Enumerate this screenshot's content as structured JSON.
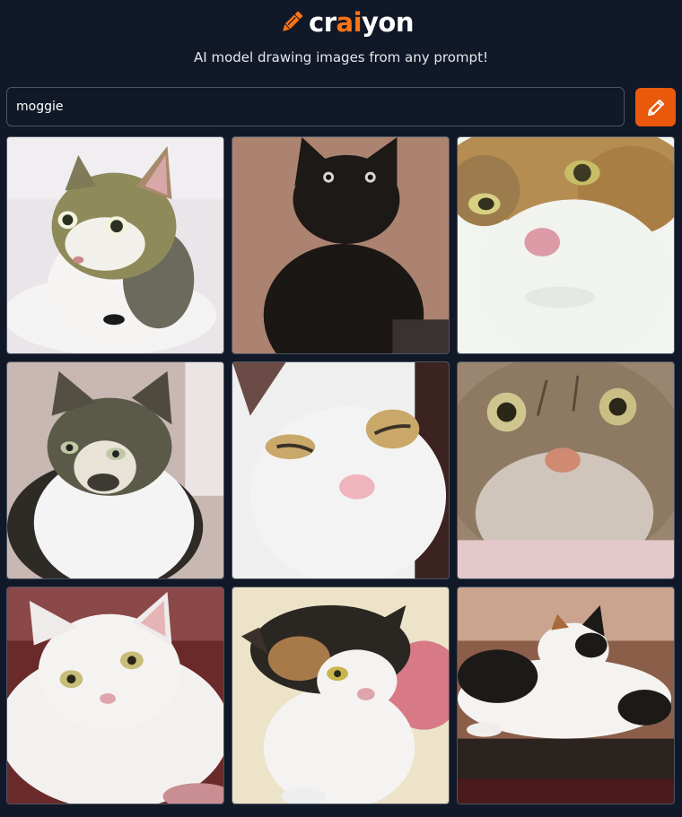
{
  "app": {
    "logo_prefix": "cr",
    "logo_accent": "ai",
    "logo_suffix": "yon",
    "tagline": "AI model drawing images from any prompt!",
    "brand_color": "#f97316"
  },
  "search": {
    "value": "moggie",
    "button_icon": "pencil-icon"
  },
  "results": [
    {
      "description": "tabby and white cat sitting"
    },
    {
      "description": "black cat with wide eyes"
    },
    {
      "description": "close-up white cat with ginger markings"
    },
    {
      "description": "tabby and white cat indoors"
    },
    {
      "description": "white cat with ginger patches, eyes squinting"
    },
    {
      "description": "close-up tabby cat face"
    },
    {
      "description": "fluffy white kitten"
    },
    {
      "description": "black, ginger and white cat sitting"
    },
    {
      "description": "calico cat lying down"
    }
  ]
}
